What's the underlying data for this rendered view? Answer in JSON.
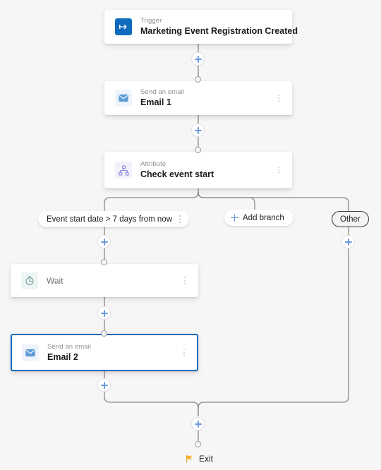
{
  "canvas": {
    "background": "#f6f6f6",
    "accent": "#0f6cbd",
    "plus_color": "#6b9bdd",
    "connector_color": "#8a8886"
  },
  "nodes": {
    "trigger": {
      "subtitle": "Trigger",
      "title": "Marketing Event Registration Created",
      "icon": "trigger-arrow-icon"
    },
    "email1": {
      "subtitle": "Send an email",
      "title": "Email 1",
      "icon": "envelope-icon",
      "menu": "more-options"
    },
    "attribute": {
      "subtitle": "Attribute",
      "title": "Check event start",
      "icon": "hierarchy-icon",
      "menu": "more-options"
    },
    "wait": {
      "title": "Wait",
      "icon": "clock-icon",
      "menu": "more-options"
    },
    "email2": {
      "subtitle": "Send an email",
      "title": "Email 2",
      "icon": "envelope-icon",
      "menu": "more-options",
      "selected": true
    },
    "exit": {
      "label": "Exit",
      "icon": "flag-icon"
    }
  },
  "branches": {
    "condition": {
      "label": "Event start date > 7 days from now",
      "menu": "more-options"
    },
    "add_branch": {
      "label": "Add branch",
      "icon": "plus-icon"
    },
    "other": {
      "label": "Other"
    }
  },
  "add_buttons": {
    "after_trigger": "Add step after trigger",
    "after_email1": "Add step after Email 1",
    "branch_left_top": "Add step in condition branch",
    "branch_other_top": "Add step in other branch",
    "after_wait": "Add step after Wait",
    "after_email2": "Add step after Email 2",
    "before_exit": "Add step before exit"
  }
}
